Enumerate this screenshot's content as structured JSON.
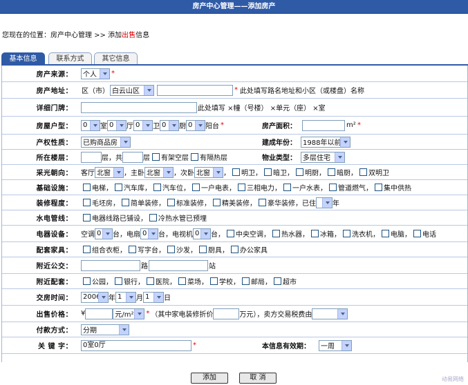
{
  "header": {
    "title": "房产中心管理——添加房产"
  },
  "breadcrumb": {
    "prefix": "您现在的位置：房产中心管理 >> 添加",
    "red": "出售",
    "suffix": "信息"
  },
  "tabs": [
    "基本信息",
    "联系方式",
    "其它信息"
  ],
  "rows": {
    "source": {
      "label": "房产来源：",
      "value": "个人"
    },
    "address": {
      "label": "房产地址：",
      "area_prefix": "区（市）",
      "area": "白云山区",
      "hint": "此处填写路名地址和小区（或楼盘）名称"
    },
    "door": {
      "label": "详细门牌：",
      "hint": "此处填写 ×幢（号楼） ×单元（座） ×室"
    },
    "layout": {
      "label": "房屋户型：",
      "room": "0",
      "room_u": "室",
      "hall": "0",
      "hall_u": "厅",
      "kitchen": "0",
      "kitchen_u": "卫",
      "bath": "0",
      "bath_u": "厨",
      "balcony": "0",
      "balcony_u": "阳台",
      "area_label": "房产面积：",
      "area_unit": "m²"
    },
    "property": {
      "label": "产权性质：",
      "value": "已购商品房",
      "year_label": "建成年份：",
      "year": "1988年以前"
    },
    "floor": {
      "label": "所在楼层：",
      "floor_u": "层，共",
      "total_u": "层",
      "opt1": "有架空层",
      "opt2": "有隔热层",
      "type_label": "物业类型：",
      "type": "多层住宅"
    },
    "orient": {
      "label": "采光朝向：",
      "living": "客厅",
      "living_v": "北窗",
      "master": "主卧",
      "master_v": "北窗",
      "second": "次卧",
      "second_v": "北窗",
      "opts": [
        "明卫",
        "暗卫",
        "明厨",
        "暗厨",
        "双明卫"
      ]
    },
    "facility": {
      "label": "基础设施：",
      "opts": [
        "电梯",
        "汽车库",
        "汽车位",
        "一户电表",
        "三相电力",
        "一户水表",
        "管道燃气",
        "集中供热"
      ]
    },
    "decor": {
      "label": "装修程度：",
      "opts": [
        "毛坯房",
        "简单装修",
        "标准装修",
        "精美装修",
        "豪华装修，已住"
      ],
      "year_u": "年"
    },
    "water": {
      "label": "水电管线：",
      "opts": [
        "电器线路已铺设",
        "冷热水管已预埋"
      ]
    },
    "appliance": {
      "label": "电器设备：",
      "ac": "空调",
      "ac_v": "0",
      "ac_u": "台，电扇",
      "fan_v": "0",
      "fan_u": "台，电视机",
      "tv_v": "0",
      "tv_u": "台，",
      "opts": [
        "中央空调",
        "热水器",
        "冰箱",
        "洗衣机",
        "电脑",
        "电话"
      ]
    },
    "furniture": {
      "label": "配套家具：",
      "opts": [
        "组合衣柜",
        "写字台",
        "沙发",
        "厨具",
        "办公家具"
      ]
    },
    "transit": {
      "label": "附近公交：",
      "road_u": "路",
      "station_u": "站"
    },
    "support": {
      "label": "附近配套：",
      "opts": [
        "公园",
        "银行",
        "医院",
        "菜场",
        "学校",
        "邮局",
        "超市"
      ]
    },
    "time": {
      "label": "交房时间：",
      "year": "2006",
      "year_u": "年",
      "month": "1",
      "month_u": "月",
      "day": "1",
      "day_u": "日"
    },
    "price": {
      "label": "出售价格：",
      "currency": "¥",
      "unit": "元/m²",
      "mid": "（其中家电装修折价",
      "wan": "万元），卖方交易税费由"
    },
    "payment": {
      "label": "付款方式：",
      "value": "分期"
    },
    "keyword": {
      "label": "关 键 字：",
      "value": "0室0厅",
      "valid_label": "本信息有效期：",
      "valid": "一周"
    }
  },
  "buttons": {
    "submit": "添加",
    "cancel": "取 消"
  },
  "watermark": "动易网络"
}
